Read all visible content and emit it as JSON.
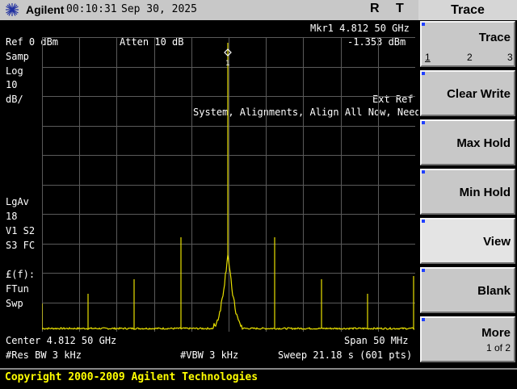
{
  "header": {
    "brand": "Agilent",
    "time": "00:10:31",
    "date": "Sep 30, 2025",
    "indicator_r": "R",
    "indicator_t": "T"
  },
  "screen": {
    "marker_label": "Mkr1  4.812 50 GHz",
    "marker_value": "-1.353 dBm",
    "ref_level": "Ref 0 dBm",
    "attenuation": "Atten 10 dB",
    "left_annotations": [
      "Samp",
      "Log",
      "10",
      "dB/"
    ],
    "avg_annotations": [
      "LgAv",
      "18",
      "V1  S2",
      "S3  FC"
    ],
    "func_annotations": [
      "£(f):",
      "FTun",
      "Swp"
    ],
    "ext_ref": "Ext Ref",
    "alignment_msg": "System, Alignments, Align All Now, Needed",
    "marker_number": "1",
    "center": "Center 4.812 50 GHz",
    "span": "Span 50 MHz",
    "res_bw": "#Res BW 3 kHz",
    "vbw": "#VBW 3 kHz",
    "sweep": "Sweep 21.18 s (601 pts)",
    "trace_color": "#e8e000",
    "grid_color": "#5a5a5a"
  },
  "footer": {
    "copyright": "Copyright 2000-2009 Agilent Technologies"
  },
  "softkeys": {
    "menu_title": "Trace",
    "trace": {
      "label": "Trace",
      "options": [
        "1",
        "2",
        "3"
      ],
      "selected": "1"
    },
    "clear_write": "Clear Write",
    "max_hold": "Max Hold",
    "min_hold": "Min Hold",
    "view": "View",
    "blank": "Blank",
    "more": "More",
    "more_page": "1 of 2"
  }
}
